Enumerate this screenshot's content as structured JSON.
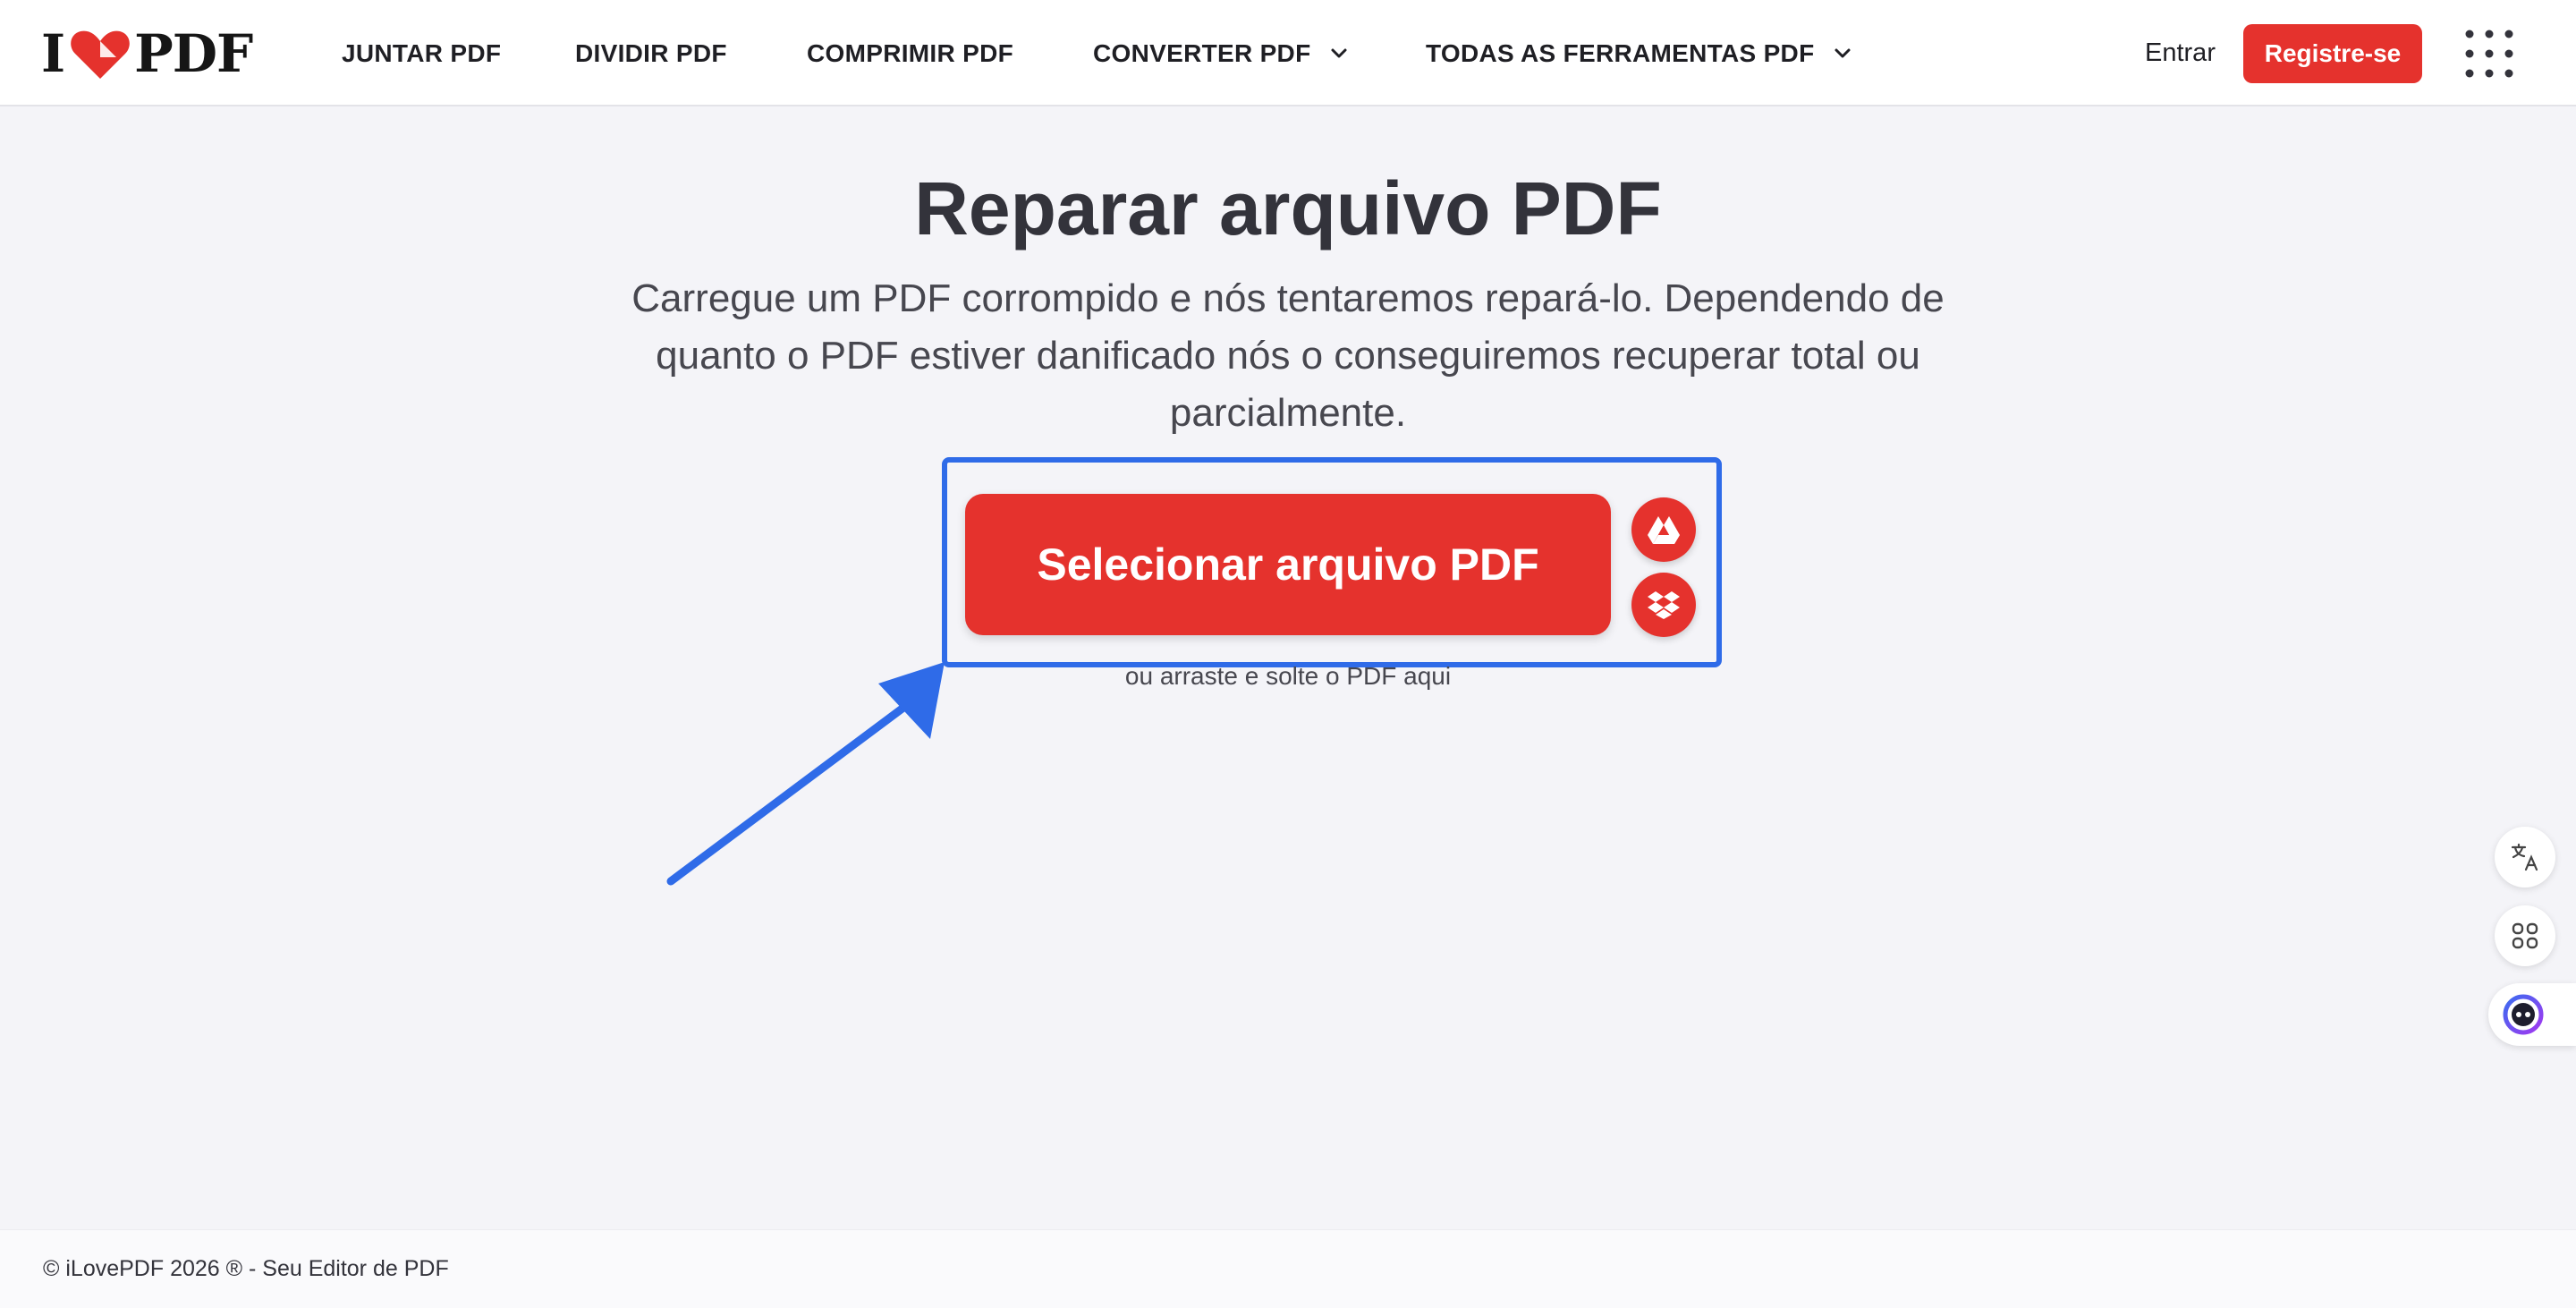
{
  "brand": {
    "logo_left": "I",
    "logo_right": "PDF",
    "accent": "#e5322d",
    "highlight": "#2f6be8"
  },
  "nav": {
    "items": [
      {
        "label": "JUNTAR PDF"
      },
      {
        "label": "DIVIDIR PDF"
      },
      {
        "label": "COMPRIMIR PDF"
      },
      {
        "label": "CONVERTER PDF",
        "icon": "chevron-down-icon"
      },
      {
        "label": "TODAS AS FERRAMENTAS PDF",
        "icon": "chevron-down-icon"
      }
    ],
    "signin": "Entrar",
    "register": "Registre-se",
    "apps_icon": "grid-icon"
  },
  "main": {
    "title": "Reparar arquivo PDF",
    "subtitle": "Carregue um PDF corrompido e nós tentaremos repará-lo. Dependendo de quanto o PDF estiver danificado nós o conseguiremos recuperar total ou parcialmente.",
    "select_button": "Selecionar arquivo PDF",
    "drop_hint": "ou arraste e solte o PDF aqui",
    "cloud_icons": [
      "google-drive-icon",
      "dropbox-icon"
    ]
  },
  "side": {
    "icons": [
      "translate-icon",
      "apps-icon",
      "assistant-icon"
    ]
  },
  "footer": {
    "text": "© iLovePDF 2026 ® - Seu Editor de PDF"
  }
}
